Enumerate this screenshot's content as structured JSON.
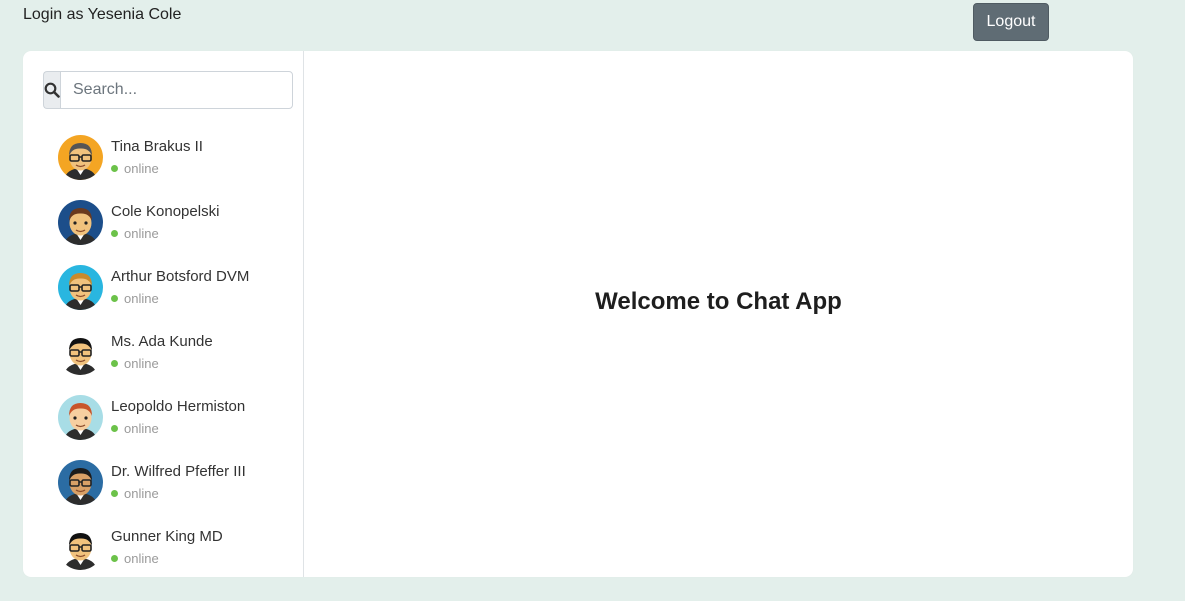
{
  "header": {
    "login_text": "Login as Yesenia Cole",
    "logout_label": "Logout"
  },
  "search": {
    "placeholder": "Search...",
    "icon": "search-icon"
  },
  "users": [
    {
      "name": "Tina Brakus II",
      "status": "online",
      "avatar_bg": "#f4a523",
      "hair": "#555555",
      "skin": "#f1c27d",
      "glasses": true
    },
    {
      "name": "Cole Konopelski",
      "status": "online",
      "avatar_bg": "#1c4e8a",
      "hair": "#6b3a1e",
      "skin": "#f1c27d",
      "glasses": false
    },
    {
      "name": "Arthur Botsford DVM",
      "status": "online",
      "avatar_bg": "#29b6e0",
      "hair": "#c98a2c",
      "skin": "#f1c27d",
      "glasses": true
    },
    {
      "name": "Ms. Ada Kunde",
      "status": "online",
      "avatar_bg": "#ffffff",
      "hair": "#111111",
      "skin": "#f1c27d",
      "glasses": true
    },
    {
      "name": "Leopoldo Hermiston",
      "status": "online",
      "avatar_bg": "#a8dde6",
      "hair": "#c8552a",
      "skin": "#f6cfa0",
      "glasses": false
    },
    {
      "name": "Dr. Wilfred Pfeffer III",
      "status": "online",
      "avatar_bg": "#2b6ca3",
      "hair": "#1b1b1b",
      "skin": "#d9a066",
      "glasses": true
    },
    {
      "name": "Gunner King MD",
      "status": "online",
      "avatar_bg": "#ffffff",
      "hair": "#111111",
      "skin": "#f1c27d",
      "glasses": true
    }
  ],
  "main": {
    "welcome_text": "Welcome to Chat App"
  },
  "colors": {
    "background": "#e3efeb",
    "logout_button": "#5f6c74",
    "online_dot": "#6cc24a"
  }
}
